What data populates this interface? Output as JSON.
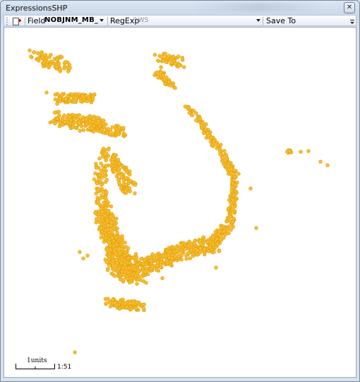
{
  "window": {
    "title": "ExpressionsSHP",
    "close_icon": "close-icon"
  },
  "toolbar": {
    "add_layer_icon": "add-layer-icon",
    "field_label": "Field",
    "field_value": "NOBJNM_MB_",
    "regexp_label": "RegExp",
    "regexp_placeholder": "^WS",
    "save_to_label": "Save To",
    "overflow_icon": "toolbar-overflow-icon"
  },
  "map": {
    "point_color": "#f5bf2e",
    "point_outline": "#e29c0f",
    "scale": {
      "label": "1units",
      "ratio": "1:51"
    }
  }
}
